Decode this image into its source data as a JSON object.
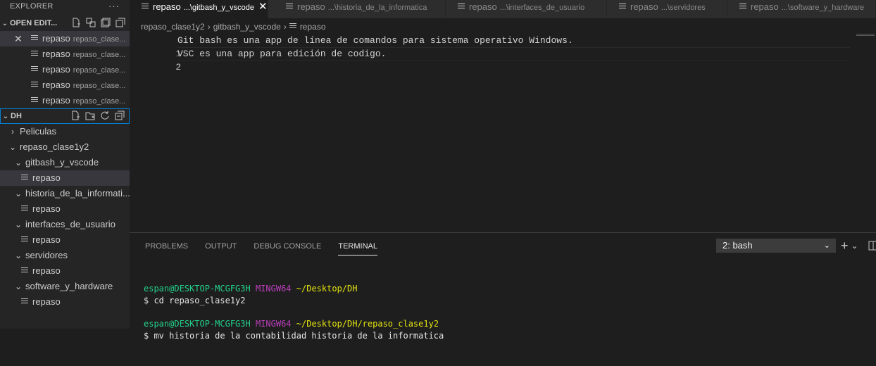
{
  "sidebar": {
    "title": "EXPLORER",
    "more": "···",
    "open_editors": {
      "label": "OPEN EDIT...",
      "items": [
        {
          "name": "repaso",
          "desc": "repaso_clase...",
          "close": "✕"
        },
        {
          "name": "repaso",
          "desc": "repaso_clase..."
        },
        {
          "name": "repaso",
          "desc": "repaso_clase..."
        },
        {
          "name": "repaso",
          "desc": "repaso_clase..."
        },
        {
          "name": "repaso",
          "desc": "repaso_clase..."
        }
      ]
    },
    "workspace": {
      "label": "DH",
      "tree": [
        {
          "label": "Peliculas",
          "chevron": "›"
        },
        {
          "label": "repaso_clase1y2",
          "chevron": "⌄"
        },
        {
          "label": "gitbash_y_vscode",
          "chevron": "⌄"
        },
        {
          "label": "repaso"
        },
        {
          "label": "historia_de_la_informati...",
          "chevron": "⌄"
        },
        {
          "label": "repaso"
        },
        {
          "label": "interfaces_de_usuario",
          "chevron": "⌄"
        },
        {
          "label": "repaso"
        },
        {
          "label": "servidores",
          "chevron": "⌄"
        },
        {
          "label": "repaso"
        },
        {
          "label": "software_y_hardware",
          "chevron": "⌄"
        },
        {
          "label": "repaso"
        }
      ]
    }
  },
  "tabs": [
    {
      "name": "repaso",
      "path": "...\\gitbash_y_vscode",
      "close": "✕"
    },
    {
      "name": "repaso",
      "path": "...\\historia_de_la_informatica"
    },
    {
      "name": "repaso",
      "path": "...\\interfaces_de_usuario"
    },
    {
      "name": "repaso",
      "path": "...\\servidores"
    },
    {
      "name": "repaso",
      "path": "...\\software_y_hardware"
    }
  ],
  "breadcrumb": {
    "parts": [
      "repaso_clase1y2",
      "gitbash_y_vscode",
      "repaso"
    ],
    "sep": "›"
  },
  "editor": {
    "lines": [
      {
        "num": "1",
        "text": "Git bash es una app de línea de comandos para sistema operativo Windows."
      },
      {
        "num": "2",
        "text": "VSC es una app para edición de codigo."
      }
    ]
  },
  "panel": {
    "tabs": [
      "PROBLEMS",
      "OUTPUT",
      "DEBUG CONSOLE",
      "TERMINAL"
    ],
    "terminal_select": "2: bash",
    "dropdown": "⌄",
    "add": "+",
    "add_menu": "⌄",
    "terminal": {
      "p1_user": "espan@DESKTOP-MCGFG3H",
      "p1_host": "MINGW64",
      "p1_path": "~/Desktop/DH",
      "cmd1": "$ cd repaso_clase1y2",
      "p2_user": "espan@DESKTOP-MCGFG3H",
      "p2_host": "MINGW64",
      "p2_path": "~/Desktop/DH/repaso_clase1y2",
      "cmd2": "$ mv historia de la contabilidad historia de la informatica"
    }
  },
  "colors": {
    "accent_focus": "#007fd4",
    "terminal_user": "#23d18b",
    "terminal_host": "#bc3fbc",
    "terminal_path": "#e5e510"
  }
}
